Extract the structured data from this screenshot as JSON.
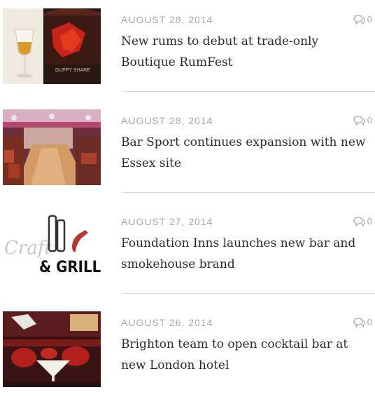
{
  "articles": [
    {
      "date": "AUGUST 28, 2014",
      "comments": "0",
      "title": "New rums to debut at trade-only Boutique RumFest",
      "thumb_label": "DUPPY SHARE"
    },
    {
      "date": "AUGUST 28, 2014",
      "comments": "0",
      "title": "Bar Sport continues expansion with new Essex site"
    },
    {
      "date": "AUGUST 27, 2014",
      "comments": "0",
      "title": "Foundation Inns launches new bar and smokehouse brand",
      "thumb_label": "& GRILL",
      "thumb_script": "Craft"
    },
    {
      "date": "AUGUST 26, 2014",
      "comments": "0",
      "title": "Brighton team to open cocktail bar at new London hotel"
    }
  ],
  "icons": {
    "comment": "comment-bubble-icon"
  },
  "colors": {
    "meta": "#a7a7a7",
    "title": "#2a2a2a",
    "divider": "#dcdcdc"
  }
}
